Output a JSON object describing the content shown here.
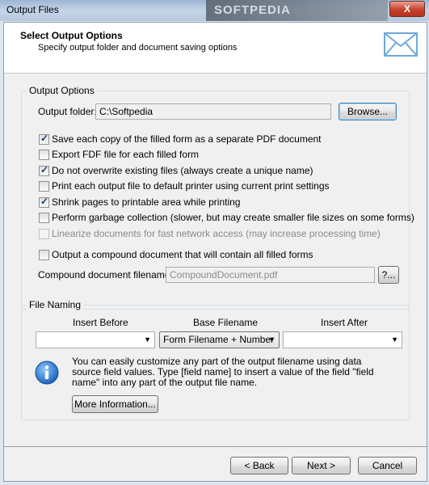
{
  "window": {
    "title": "Output Files",
    "watermark": "SOFTPEDIA",
    "close_label": "X"
  },
  "header": {
    "title": "Select Output Options",
    "subtitle": "Specify output folder and document saving options",
    "icon": "envelope-icon"
  },
  "output_options": {
    "legend": "Output Options",
    "folder_label": "Output folder:",
    "folder_value": "C:\\Softpedia",
    "browse_label": "Browse...",
    "checkboxes": [
      {
        "label": "Save each copy of the filled form as a separate PDF document",
        "checked": true,
        "disabled": false
      },
      {
        "label": "Export FDF file for each filled form",
        "checked": false,
        "disabled": false
      },
      {
        "label": "Do not overwrite existing files (always create a unique name)",
        "checked": true,
        "disabled": false
      },
      {
        "label": "Print each output file to default printer using current print settings",
        "checked": false,
        "disabled": false
      },
      {
        "label": "Shrink pages to printable area while printing",
        "checked": true,
        "disabled": false
      },
      {
        "label": "Perform garbage collection  (slower, but may create smaller file sizes on some forms)",
        "checked": false,
        "disabled": false
      },
      {
        "label": "Linearize documents for fast network access (may increase processing time)",
        "checked": false,
        "disabled": true
      }
    ],
    "compound_checkbox": {
      "label": "Output a compound document that will contain all filled forms",
      "checked": false
    },
    "compound_label": "Compound document filename:",
    "compound_value": "CompoundDocument.pdf",
    "compound_button": "?..."
  },
  "file_naming": {
    "legend": "File Naming",
    "insert_before_label": "Insert Before",
    "base_filename_label": "Base Filename",
    "insert_after_label": "Insert After",
    "insert_before_value": "",
    "base_filename_value": "Form Filename + Number",
    "insert_after_value": "",
    "info_text": "You can easily customize any part of the output filename using data source field values. Type [field name] to insert a value of the field \"field name\" into any part of the output file name.",
    "more_info_label": "More Information..."
  },
  "footer": {
    "back_label": "< Back",
    "next_label": "Next >",
    "cancel_label": "Cancel"
  }
}
